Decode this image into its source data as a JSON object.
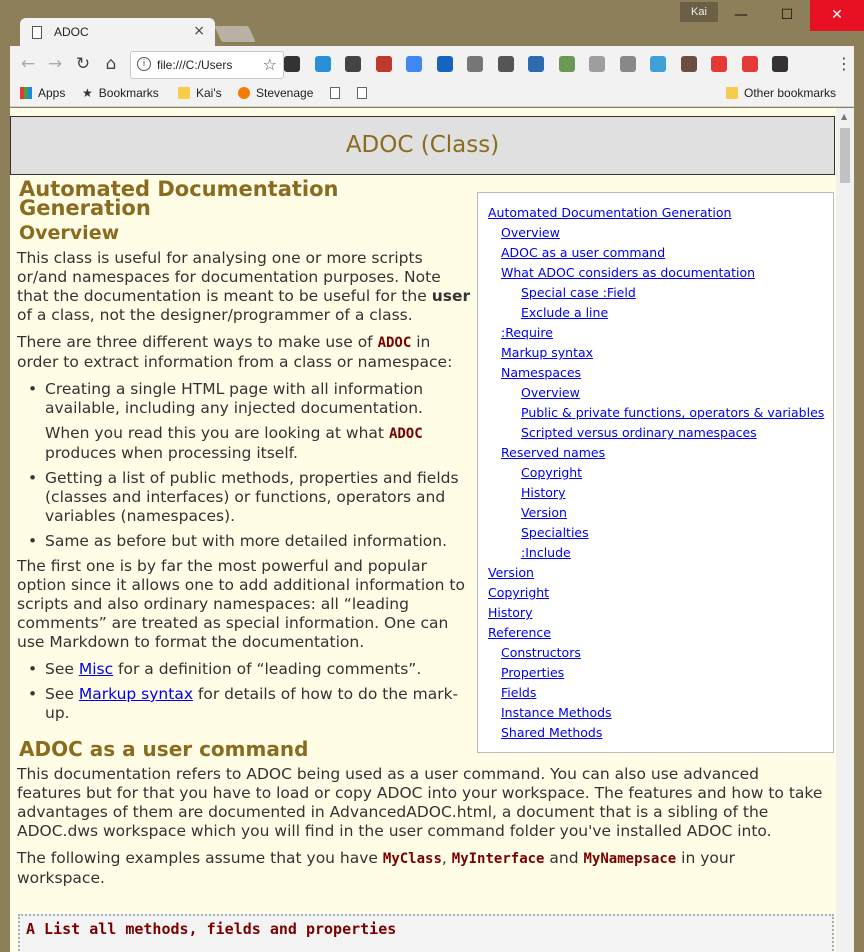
{
  "browser": {
    "tab_title": "ADOC",
    "tab_close": "×",
    "user_name": "Kai",
    "url": "file:///C:/Users",
    "menu_dots": "⋮",
    "info_glyph": "i",
    "window_buttons": {
      "minimize": "—",
      "maximize": "☐",
      "close": "✕"
    },
    "nav": {
      "back": "←",
      "forward": "→",
      "reload": "↻",
      "home": "⌂",
      "bookmark_star": "☆"
    },
    "extensions": [
      {
        "name": "pen-extension-icon",
        "color": "#333333"
      },
      {
        "name": "screenshot-extension-icon",
        "color": "#2a8fd8"
      },
      {
        "name": "evernote-extension-icon",
        "color": "#444444"
      },
      {
        "name": "book-extension-icon",
        "color": "#c0392b"
      },
      {
        "name": "translate-extension-icon",
        "color": "#4285f4"
      },
      {
        "name": "v-extension-icon",
        "color": "#1565c0"
      },
      {
        "name": "person-extension-icon",
        "color": "#777777"
      },
      {
        "name": "film-extension-icon",
        "color": "#555555"
      },
      {
        "name": "capture-extension-icon",
        "color": "#2b6cb0"
      },
      {
        "name": "js-extension-icon",
        "color": "#6a9955"
      },
      {
        "name": "g-extension-icon",
        "color": "#9e9e9e"
      },
      {
        "name": "window-extension-icon",
        "color": "#888888"
      },
      {
        "name": "s-extension-icon",
        "color": "#3fa0d8"
      },
      {
        "name": "brush-extension-icon",
        "color": "#6d4c41"
      },
      {
        "name": "stop-extension-icon",
        "color": "#e53935"
      },
      {
        "name": "rocket-extension-icon",
        "color": "#e53935"
      },
      {
        "name": "robot-extension-icon",
        "color": "#333333"
      }
    ]
  },
  "bookmarks": {
    "apps": "Apps",
    "bookmarks": "Bookmarks",
    "kais": "Kai's",
    "stevenage": "Stevenage",
    "other": "Other bookmarks"
  },
  "page": {
    "heading": "ADOC (Class)",
    "title": "Automated Documentation Generation",
    "overview_h": "Overview",
    "p1a": "This class is useful for analysing one or more scripts or/and namespaces for documentation purposes. Note that the documentation is meant to be useful for the ",
    "p1b": "user",
    "p1c": " of a class, not the designer/programmer of a class.",
    "p2a": "There are three different ways to make use of ",
    "adoc": "ADOC",
    "p2b": " in order to extract information from a class or namespace:",
    "li1": "Creating a single HTML page with all information available, including any injected documentation.",
    "li1_sub_a": "When you read this you are looking at what ",
    "li1_sub_b": " produces when processing itself.",
    "li2": "Getting a list of public methods, properties and fields (classes and interfaces) or functions, operators and variables (namespaces).",
    "li3": "Same as before but with more detailed information.",
    "p3": "The first one is by far the most powerful and popular option since it allows one to add additional information to scripts and also ordinary namespaces: all “leading comments” are treated as special information. One can use Markdown to format the documentation.",
    "see1a": "See ",
    "see1_link": "Misc",
    "see1b": " for a definition of “leading comments”.",
    "see2a": "See ",
    "see2_link": "Markup syntax",
    "see2b": " for details of how to do the mark-up.",
    "user_cmd_h": "ADOC as a user command",
    "p4": "This documentation refers to ADOC being used as a user command. You can also use advanced features but for that you have to load or copy ADOC into your workspace. The features and how to take advantages of them are documented in AdvancedADOC.html, a document that is a sibling of the ADOC.dws workspace which you will find in the user command folder you've installed ADOC into.",
    "p5a": "The following examples assume that you have ",
    "myclass": "MyClass",
    "comma": ", ",
    "myinterface": "MyInterface",
    "and": " and ",
    "mynamespace": "MyNamepsace",
    "p5b": " in your workspace.",
    "code_line": "A List all methods, fields and properties"
  },
  "toc": [
    {
      "label": "Automated Documentation Generation",
      "level": 1
    },
    {
      "label": "Overview",
      "level": 2
    },
    {
      "label": "ADOC as a user command",
      "level": 2
    },
    {
      "label": "What ADOC considers as documentation",
      "level": 2
    },
    {
      "label": "Special case :Field",
      "level": 3
    },
    {
      "label": "Exclude a line",
      "level": 3
    },
    {
      "label": ":Require",
      "level": 2
    },
    {
      "label": "Markup syntax",
      "level": 2
    },
    {
      "label": "Namespaces",
      "level": 2
    },
    {
      "label": "Overview",
      "level": 3
    },
    {
      "label": "Public & private functions, operators & variables",
      "level": 3
    },
    {
      "label": "Scripted versus ordinary namespaces",
      "level": 3
    },
    {
      "label": "Reserved names",
      "level": 2
    },
    {
      "label": "Copyright",
      "level": 3
    },
    {
      "label": "History",
      "level": 3
    },
    {
      "label": "Version",
      "level": 3
    },
    {
      "label": "Specialties",
      "level": 3
    },
    {
      "label": ":Include",
      "level": 3
    },
    {
      "label": "Version",
      "level": 1
    },
    {
      "label": "Copyright",
      "level": 1
    },
    {
      "label": "History",
      "level": 1
    },
    {
      "label": "Reference",
      "level": 1
    },
    {
      "label": "Constructors",
      "level": 2
    },
    {
      "label": "Properties",
      "level": 2
    },
    {
      "label": "Fields",
      "level": 2
    },
    {
      "label": "Instance Methods",
      "level": 2
    },
    {
      "label": "Shared Methods",
      "level": 2
    }
  ]
}
